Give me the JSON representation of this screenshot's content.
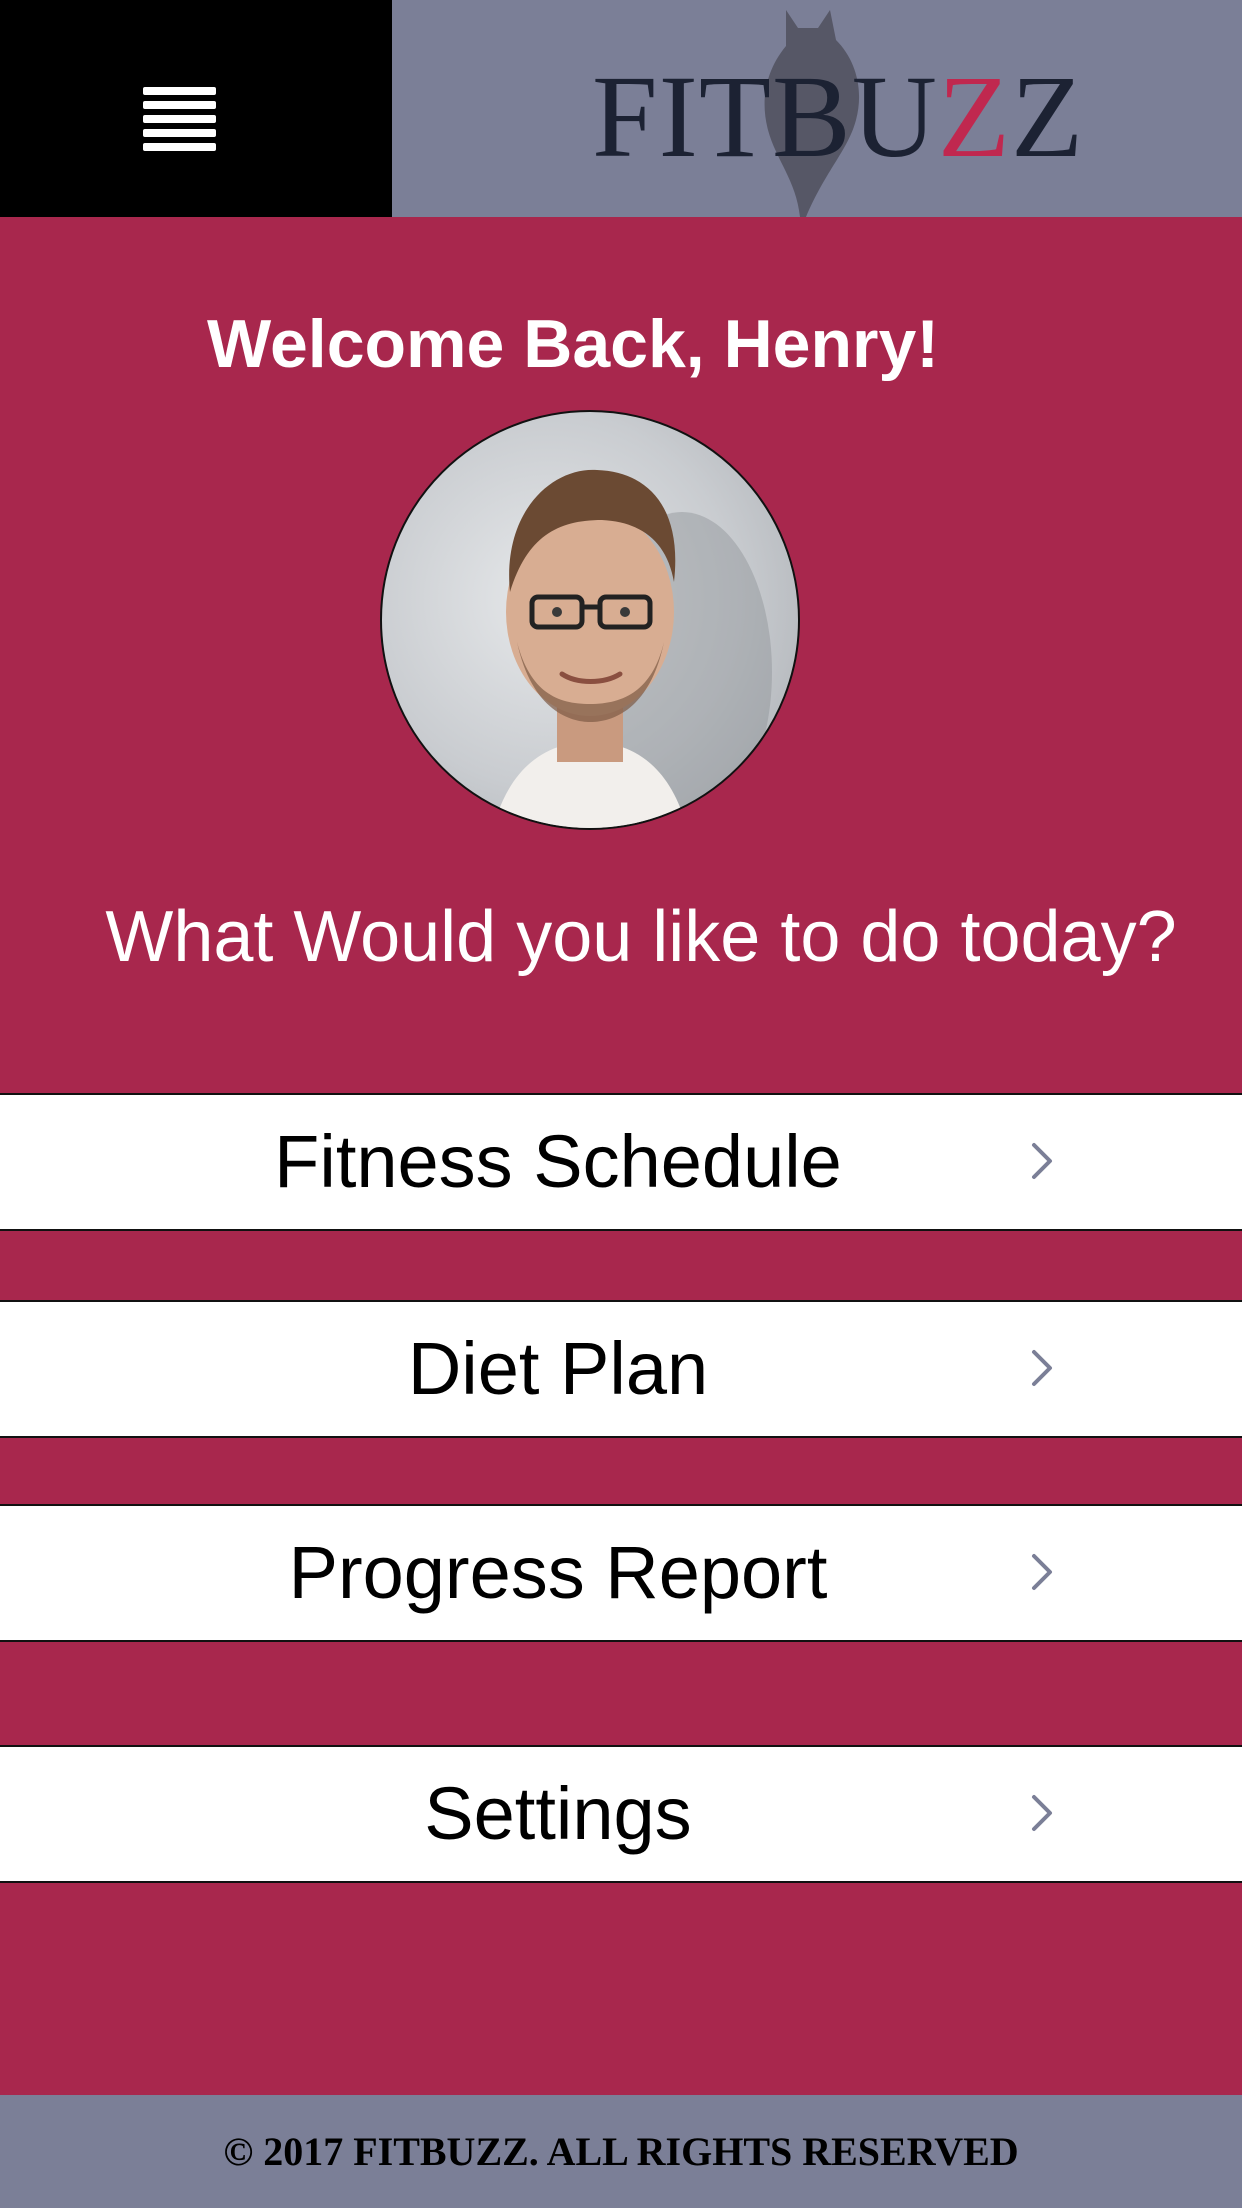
{
  "header": {
    "menu_icon": "hamburger-menu-icon",
    "logo_text_prefix": "FITBU",
    "logo_text_accent": "Z",
    "logo_text_suffix": "Z"
  },
  "welcome": {
    "greeting": "Welcome Back, Henry!",
    "question": "What Would you like to do today?"
  },
  "menu": {
    "items": [
      {
        "label": "Fitness Schedule",
        "icon": "chevron-right-icon"
      },
      {
        "label": "Diet Plan",
        "icon": "chevron-right-icon"
      },
      {
        "label": "Progress Report",
        "icon": "chevron-right-icon"
      },
      {
        "label": "Settings",
        "icon": "chevron-right-icon"
      }
    ]
  },
  "footer": {
    "copyright": "© 2017 FITBUZZ. ALL RIGHTS RESERVED"
  },
  "colors": {
    "background": "#a8274d",
    "header": "#7b7f97",
    "menu_box": "#000000",
    "logo_accent": "#c0284f",
    "chevron": "#7b7f97"
  }
}
